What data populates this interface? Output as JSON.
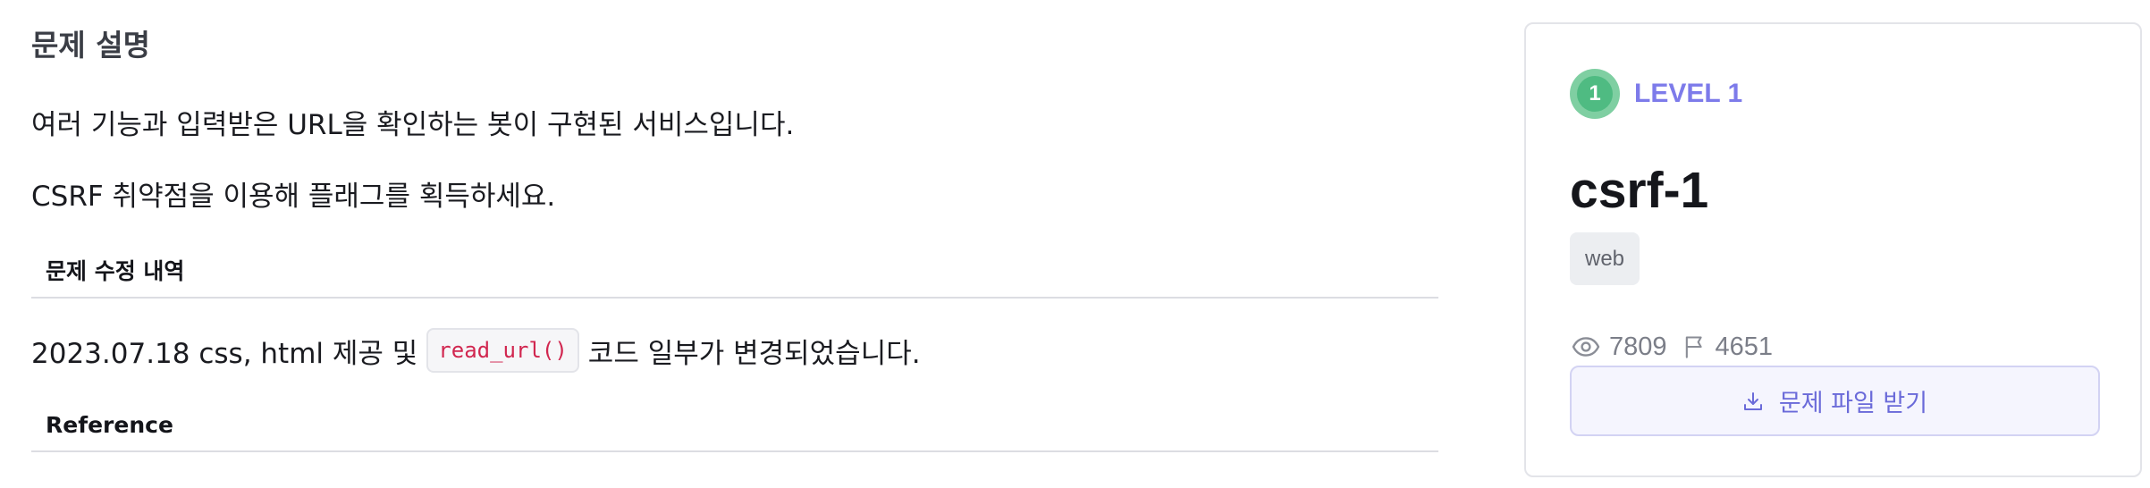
{
  "description": {
    "section_title": "문제 설명",
    "paragraph_1": "여러 기능과 입력받은 URL을 확인하는 봇이 구현된 서비스입니다.",
    "paragraph_2": "CSRF 취약점을 이용해 플래그를 획득하세요.",
    "changelog_header": "문제 수정 내역",
    "changelog_before": "2023.07.18 css, html 제공 및",
    "changelog_code": "read_url()",
    "changelog_after": "코드 일부가 변경되었습니다.",
    "reference_header": "Reference"
  },
  "card": {
    "level_number": "1",
    "level_label": "LEVEL 1",
    "title": "csrf-1",
    "tag": "web",
    "views": "7809",
    "solves": "4651",
    "download_label": "문제 파일 받기",
    "icons": {
      "views": "eye-icon",
      "solves": "flag-icon",
      "download": "download-icon"
    },
    "colors": {
      "level_accent": "#7d7bea",
      "badge_green": "#4fbb82",
      "code_text": "#d1264f"
    }
  }
}
